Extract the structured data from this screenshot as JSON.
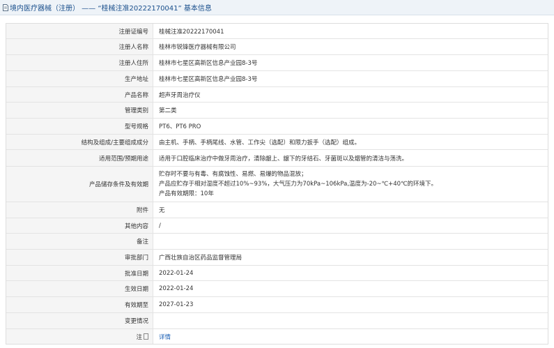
{
  "header": {
    "title": "境内医疗器械（注册） —— “桂械注准20222170041” 基本信息"
  },
  "rows": [
    {
      "label": "注册证编号",
      "value": "桂械注准20222170041"
    },
    {
      "label": "注册人名称",
      "value": "桂林市锐锋医疗器械有限公司"
    },
    {
      "label": "注册人住所",
      "value": "桂林市七星区高新区信息产业园8-3号"
    },
    {
      "label": "生产地址",
      "value": "桂林市七星区高新区信息产业园8-3号"
    },
    {
      "label": "产品名称",
      "value": "超声牙周治疗仪"
    },
    {
      "label": "管理类别",
      "value": "第二类"
    },
    {
      "label": "型号规格",
      "value": "PT6、PT6 PRO"
    },
    {
      "label": "结构及组成/主要组成成分",
      "value": "由主机、手柄、手柄尾线、水管、工作尖（选配）和限力扳手（选配）组成。"
    },
    {
      "label": "适用范围/预期用途",
      "value": "适用于口腔临床治疗中做牙周治疗，清除龈上、龈下的牙结石、牙菌斑以及烟管的清洁与荡洗。"
    },
    {
      "label": "产品储存条件及有效期",
      "lines": [
        "贮存时不要与有毒、有腐蚀性、易燃、易爆的物品混放；",
        "产品应贮存于相对湿度不超过10%~93%，大气压力为70kPa~106kPa,温度为-20~℃+40℃的环境下。",
        "产品有效期限：10年"
      ]
    },
    {
      "label": "附件",
      "value": "无"
    },
    {
      "label": "其他内容",
      "value": "/"
    },
    {
      "label": "备注",
      "value": ""
    },
    {
      "label": "审批部门",
      "value": "广西壮族自治区药品监督管理局"
    },
    {
      "label": "批准日期",
      "value": "2022-01-24"
    },
    {
      "label": "生效日期",
      "value": "2022-01-24"
    },
    {
      "label": "有效期至",
      "value": "2027-01-23"
    },
    {
      "label": "变更情况",
      "value": ""
    },
    {
      "label": "注",
      "value": "详情"
    }
  ]
}
